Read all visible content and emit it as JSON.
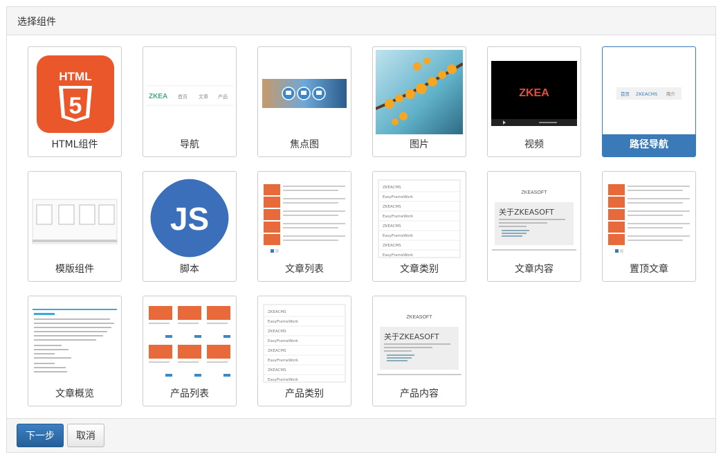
{
  "panel": {
    "title": "选择组件"
  },
  "widgets": [
    {
      "label": "HTML组件"
    },
    {
      "label": "导航"
    },
    {
      "label": "焦点图"
    },
    {
      "label": "图片"
    },
    {
      "label": "视频"
    },
    {
      "label": "路径导航",
      "selected": true
    },
    {
      "label": "模版组件"
    },
    {
      "label": "脚本"
    },
    {
      "label": "文章列表"
    },
    {
      "label": "文章类别"
    },
    {
      "label": "文章内容"
    },
    {
      "label": "置顶文章"
    },
    {
      "label": "文章概览"
    },
    {
      "label": "产品列表"
    },
    {
      "label": "产品类别"
    },
    {
      "label": "产品内容"
    }
  ],
  "thumbs": {
    "html5_text": "HTML",
    "html5_number": "5",
    "nav_brand": "ZKEA",
    "nav_items": [
      "首页",
      "文章",
      "产品"
    ],
    "video_brand": "ZKEA",
    "breadcrumb": [
      "首页",
      "ZKEACMS",
      "简介"
    ],
    "js_text": "JS",
    "category_items": [
      "ZKEACMS",
      "EasyFrameWork",
      "ZKEACMS",
      "EasyFrameWork",
      "ZKEACMS",
      "EasyFrameWork",
      "ZKEACMS",
      "EasyFrameWork"
    ],
    "content_brand": "ZKEASOFT",
    "content_title": "关于ZKEASOFT"
  },
  "footer": {
    "next_label": "下一步",
    "cancel_label": "取消"
  },
  "colors": {
    "primary": "#3a7ab8",
    "html5": "#e9572b",
    "js": "#3b6fba"
  }
}
